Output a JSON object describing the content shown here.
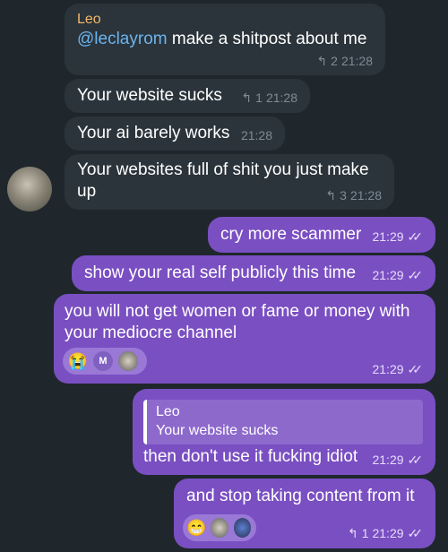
{
  "messages": {
    "m1": {
      "sender": "Leo",
      "mention": "@leclayrom",
      "text": " make a shitpost about me",
      "replies": "2",
      "time": "21:28"
    },
    "m2": {
      "text": "Your website sucks",
      "replies": "1",
      "time": "21:28"
    },
    "m3": {
      "text": "Your ai barely works",
      "time": "21:28"
    },
    "m4": {
      "line1": "Your websites full of shit you just make",
      "line2": "up",
      "replies": "3",
      "time": "21:28"
    },
    "m5": {
      "text": "cry more scammer",
      "time": "21:29"
    },
    "m6": {
      "text": "show your real self publicly this time",
      "time": "21:29"
    },
    "m7": {
      "line1": "you will not get women or fame or money with",
      "line2": "your mediocre channel",
      "time": "21:29",
      "reaction_emoji": "😭",
      "reaction_initial": "M"
    },
    "m8": {
      "quote_name": "Leo",
      "quote_text": "Your website sucks",
      "text": "then don't use it fucking idiot",
      "time": "21:29"
    },
    "m9": {
      "text": "and stop taking content from it",
      "reaction_emoji": "😁",
      "replies": "1",
      "time": "21:29"
    }
  },
  "icons": {
    "reply": "↰",
    "check": "✓✓"
  },
  "colors": {
    "background": "#1f272c",
    "incoming": "#2b343b",
    "outgoing": "#7a4fc2",
    "sender": "#f2b766",
    "mention": "#6cb4ee"
  }
}
